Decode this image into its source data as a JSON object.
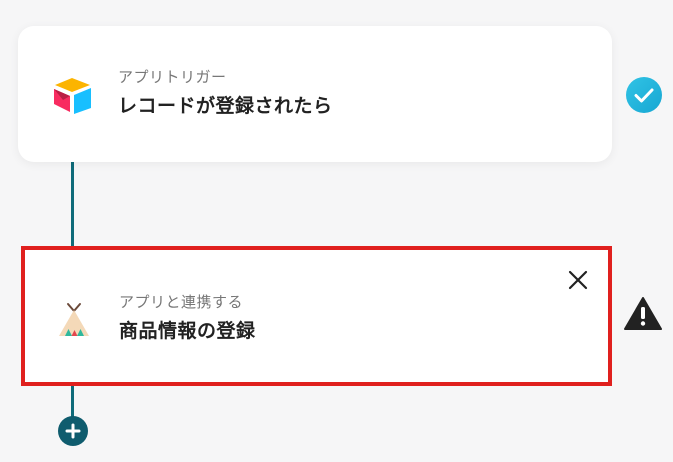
{
  "trigger": {
    "label": "アプリトリガー",
    "title": "レコードが登録されたら",
    "app_icon": "airtable-icon",
    "status": "check-circle-icon"
  },
  "action": {
    "label": "アプリと連携する",
    "title": "商品情報の登録",
    "app_icon": "teepee-tent-icon",
    "status": "warning-icon"
  },
  "colors": {
    "connector": "#0f6b7a",
    "highlight_border": "#e0201e",
    "check_bg": "#1fb4dd",
    "add_button": "#0f5c6e"
  }
}
